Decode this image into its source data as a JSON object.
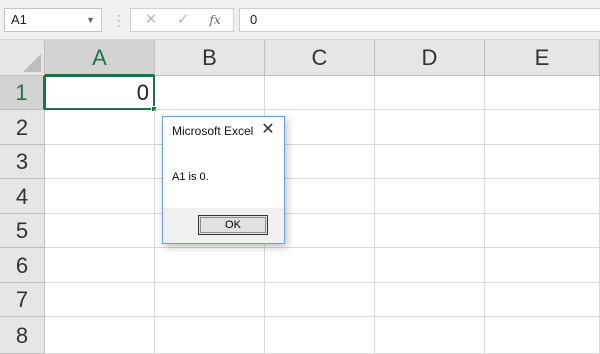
{
  "formula_bar": {
    "name_box": "A1",
    "cancel_icon": "✕",
    "enter_icon": "✓",
    "fx_label": "fx",
    "formula_value": "0"
  },
  "columns": [
    "A",
    "B",
    "C",
    "D",
    "E"
  ],
  "rows": [
    "1",
    "2",
    "3",
    "4",
    "5",
    "6",
    "7",
    "8"
  ],
  "cells": {
    "A1": "0"
  },
  "selected_cell": "A1",
  "dialog": {
    "title": "Microsoft Excel",
    "message": "A1 is 0.",
    "ok_label": "OK",
    "close_icon": "✕"
  },
  "colors": {
    "accent_green": "#217346",
    "dialog_border": "#6f9dd8"
  }
}
